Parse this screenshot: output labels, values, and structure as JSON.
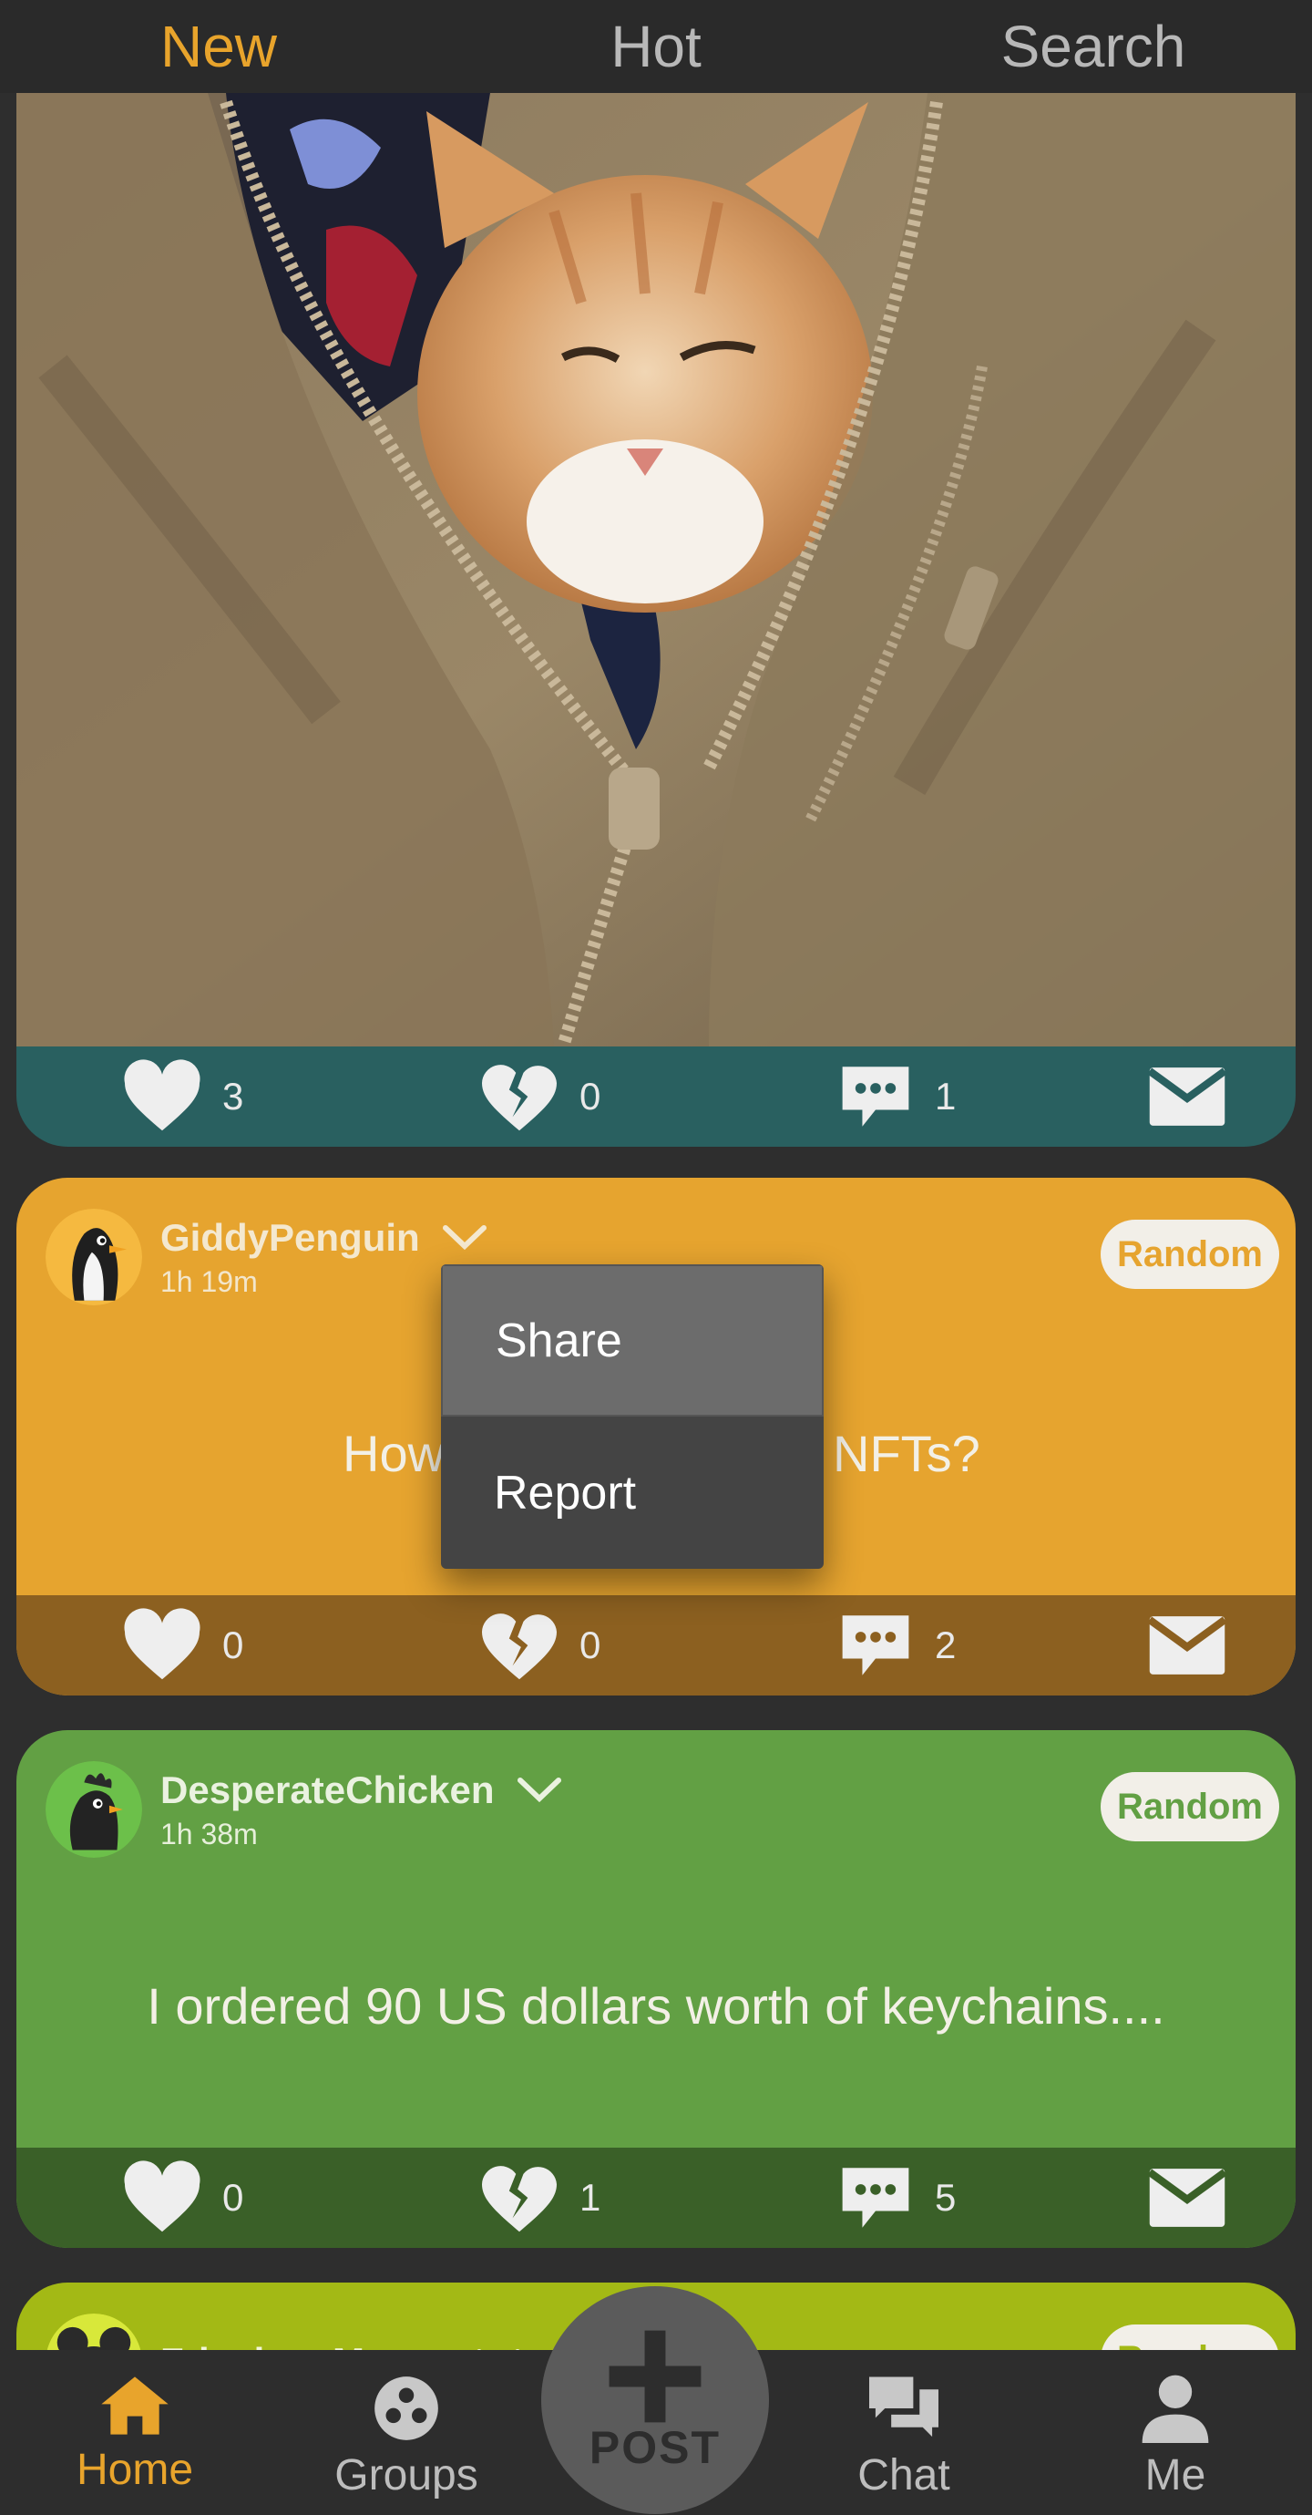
{
  "tabs": [
    {
      "label": "New",
      "active": true
    },
    {
      "label": "Hot",
      "active": false
    },
    {
      "label": "Search",
      "active": false
    }
  ],
  "photo_post": {
    "image_alt": "cat peeking out of a zipped fleece jacket",
    "likes": "3",
    "dislikes": "0",
    "comments": "1",
    "bar_color": "#296060"
  },
  "posts": [
    {
      "username": "GiddyPenguin",
      "time": "1h 19m",
      "badge": "Random",
      "body_left": "How",
      "body_right": "NFTs?",
      "likes": "0",
      "dislikes": "0",
      "comments": "2",
      "avatar": "penguin-icon",
      "card_color": "#e6a42f",
      "bar_color": "#8c6020"
    },
    {
      "username": "DesperateChicken",
      "time": "1h 38m",
      "badge": "Random",
      "body": "I ordered 90 US dollars worth of keychains....",
      "likes": "0",
      "dislikes": "1",
      "comments": "5",
      "avatar": "chicken-icon",
      "card_color": "#62a044",
      "bar_color": "#3a6028"
    },
    {
      "username": "FrivolousMouse",
      "badge": "Random",
      "avatar": "mouse-icon",
      "card_color": "#a3b915"
    }
  ],
  "menu": {
    "items": [
      "Share",
      "Report"
    ]
  },
  "bottom_nav": {
    "items": [
      {
        "label": "Home",
        "icon": "home-icon",
        "active": true
      },
      {
        "label": "Groups",
        "icon": "groups-icon",
        "active": false
      },
      {
        "label": "Chat",
        "icon": "chat-icon",
        "active": false
      },
      {
        "label": "Me",
        "icon": "person-icon",
        "active": false
      }
    ],
    "post_label": "POST"
  },
  "colors": {
    "accent": "#e8a42c",
    "background": "#2e2e2e"
  }
}
